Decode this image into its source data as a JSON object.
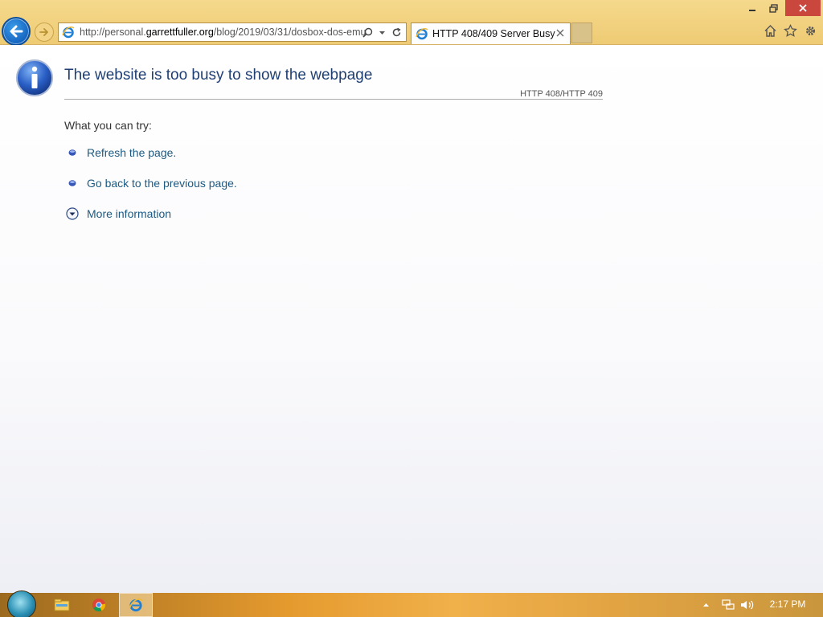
{
  "window": {
    "address": {
      "prefix": "http://personal.",
      "domain": "garrettfuller.org",
      "path": "/blog/2019/03/31/dosbox-dos-emu"
    },
    "tab_title": "HTTP 408/409 Server Busy",
    "buttons": {
      "back": "back-arrow-icon",
      "forward": "forward-arrow-icon",
      "minimize": "minimize-icon",
      "restore": "restore-icon",
      "close": "close-icon",
      "home": "home-icon",
      "favorites": "star-icon",
      "tools": "gear-icon"
    }
  },
  "page": {
    "title": "The website is too busy to show the webpage",
    "error_code": "HTTP 408/HTTP 409",
    "try_label": "What you can try:",
    "options": [
      {
        "label": "Refresh the page.",
        "icon": "bullet-icon"
      },
      {
        "label": "Go back to the previous page.",
        "icon": "bullet-icon"
      },
      {
        "label": "More information",
        "icon": "expand-circle-icon"
      }
    ]
  },
  "taskbar": {
    "items": [
      "file-explorer-icon",
      "chrome-icon",
      "internet-explorer-icon"
    ],
    "clock": "2:17 PM"
  },
  "colors": {
    "chrome_bg": "#eecb74",
    "title_text": "#1f3f73",
    "link_text": "#1d5a82",
    "close_button": "#c9473d"
  }
}
